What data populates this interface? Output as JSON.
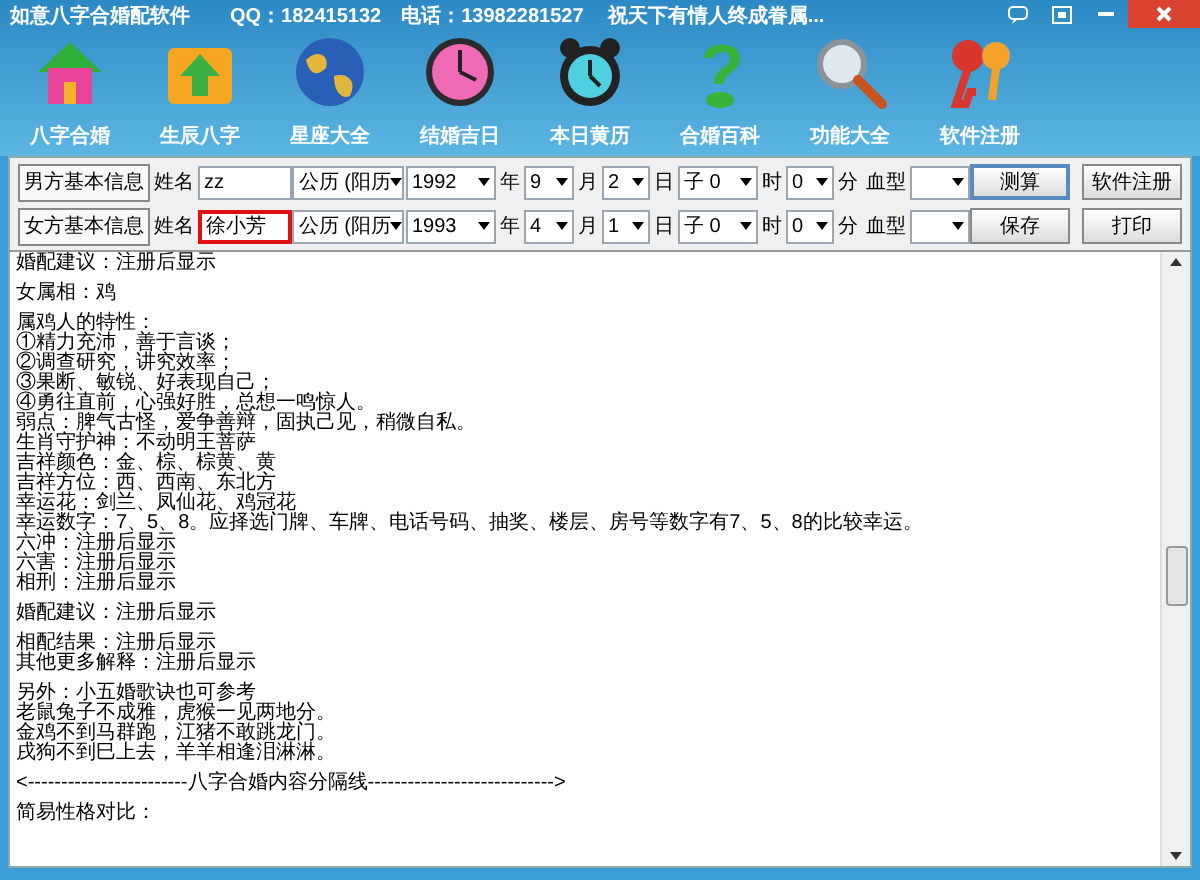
{
  "window": {
    "title": "如意八字合婚配软件",
    "qq": "QQ：182415132",
    "phone": "电话：13982281527",
    "slogan": "祝天下有情人终成眷属..."
  },
  "toolbar": [
    {
      "label": "八字合婚"
    },
    {
      "label": "生辰八字"
    },
    {
      "label": "星座大全"
    },
    {
      "label": "结婚吉日"
    },
    {
      "label": "本日黄历"
    },
    {
      "label": "合婚百科"
    },
    {
      "label": "功能大全"
    },
    {
      "label": "软件注册"
    }
  ],
  "form_rows": [
    {
      "section": "男方基本信息",
      "name_label": "姓名",
      "name": "zz",
      "focused": false,
      "calendar": "公历 (阳历",
      "year": "1992",
      "year_unit": "年",
      "month": "9",
      "month_unit": "月",
      "day": "2",
      "day_unit": "日",
      "hour": "子 0",
      "hour_unit": "时",
      "minute": "0",
      "minute_unit": "分",
      "blood_label": "血型",
      "buttons": [
        "测算",
        "软件注册"
      ],
      "primary": true
    },
    {
      "section": "女方基本信息",
      "name_label": "姓名",
      "name": "徐小芳",
      "focused": true,
      "calendar": "公历 (阳历",
      "year": "1993",
      "year_unit": "年",
      "month": "4",
      "month_unit": "月",
      "day": "1",
      "day_unit": "日",
      "hour": "子 0",
      "hour_unit": "时",
      "minute": "0",
      "minute_unit": "分",
      "blood_label": "血型",
      "buttons": [
        "保存",
        "打印"
      ],
      "primary": false
    }
  ],
  "result_paragraphs": [
    [
      "婚配建议：注册后显示"
    ],
    [
      "女属相：鸡"
    ],
    [
      "属鸡人的特性：",
      "①精力充沛，善于言谈；",
      "②调查研究，讲究效率；",
      "③果断、敏锐、好表现自己；",
      "④勇往直前，心强好胜，总想一鸣惊人。",
      "弱点：脾气古怪，爱争善辩，固执己见，稍微自私。",
      "生肖守护神：不动明王菩萨",
      "吉祥颜色：金、棕、棕黄、黄",
      "吉祥方位：西、西南、东北方",
      "幸运花：剑兰、凤仙花、鸡冠花",
      "幸运数字：7、5、8。应择选门牌、车牌、电话号码、抽奖、楼层、房号等数字有7、5、8的比较幸运。",
      "六冲：注册后显示",
      "六害：注册后显示",
      "相刑：注册后显示"
    ],
    [
      "婚配建议：注册后显示"
    ],
    [
      "相配结果：注册后显示",
      "其他更多解释：注册后显示"
    ],
    [
      "另外：小五婚歌诀也可参考",
      "老鼠兔子不成雅，虎猴一见两地分。",
      "金鸡不到马群跑，江猪不敢跳龙门。",
      "戌狗不到巳上去，羊羊相逢泪淋淋。"
    ],
    [
      "<------------------------八字合婚内容分隔线---------------------------->"
    ],
    [
      "简易性格对比："
    ]
  ]
}
